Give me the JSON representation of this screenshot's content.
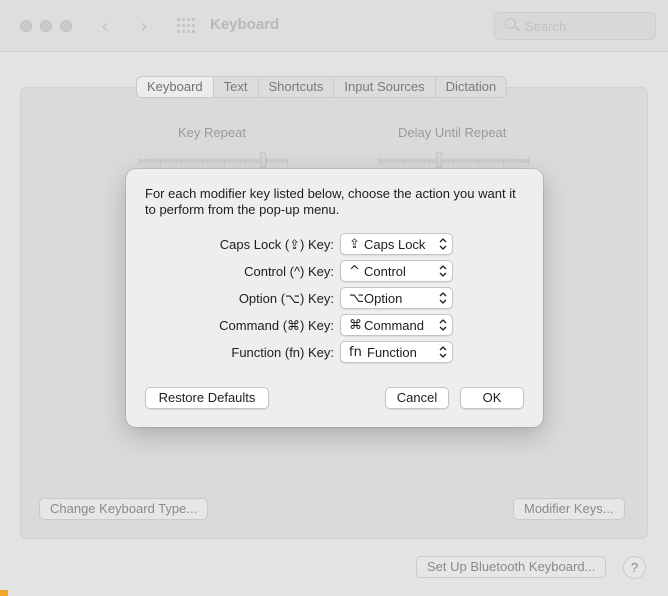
{
  "window": {
    "title": "Keyboard"
  },
  "search": {
    "placeholder": "Search"
  },
  "tabs": [
    {
      "label": "Keyboard",
      "active": true
    },
    {
      "label": "Text",
      "active": false
    },
    {
      "label": "Shortcuts",
      "active": false
    },
    {
      "label": "Input Sources",
      "active": false
    },
    {
      "label": "Dictation",
      "active": false
    }
  ],
  "sliders": {
    "key_repeat": {
      "label": "Key Repeat"
    },
    "delay_until_repeat": {
      "label": "Delay Until Repeat"
    }
  },
  "buttons": {
    "change_keyboard_type": "Change Keyboard Type...",
    "modifier_keys": "Modifier Keys...",
    "bluetooth_keyboard": "Set Up Bluetooth Keyboard...",
    "help": "?"
  },
  "dialog": {
    "message": "For each modifier key listed below, choose the action you want it to perform from the pop-up menu.",
    "rows": [
      {
        "label": "Caps Lock (⇪) Key:",
        "symbol": "⇪",
        "value": "Caps Lock"
      },
      {
        "label": "Control (^) Key:",
        "symbol": "^",
        "value": "Control"
      },
      {
        "label": "Option (⌥) Key:",
        "symbol": "⌥",
        "value": "Option"
      },
      {
        "label": "Command (⌘) Key:",
        "symbol": "⌘",
        "value": "Command"
      },
      {
        "label": "Function (fn) Key:",
        "symbol": "fn",
        "value": "Function"
      }
    ],
    "restore_defaults": "Restore Defaults",
    "cancel": "Cancel",
    "ok": "OK"
  }
}
